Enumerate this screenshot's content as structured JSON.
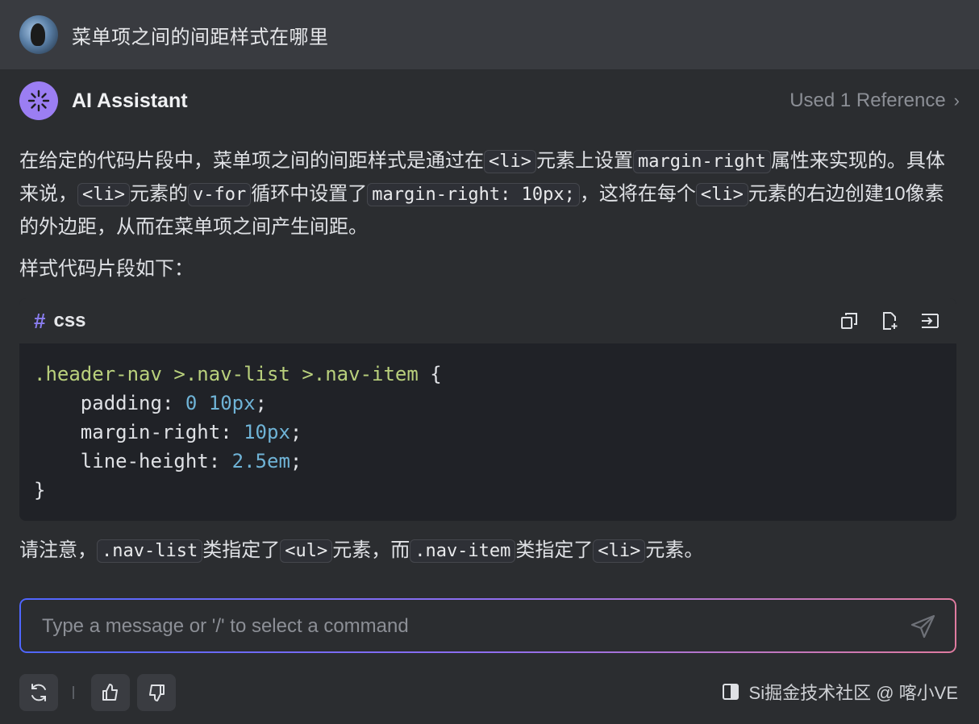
{
  "header": {
    "title": "菜单项之间的间距样式在哪里"
  },
  "assistant": {
    "name": "AI Assistant",
    "reference": "Used 1 Reference"
  },
  "answer": {
    "p1_a": "在给定的代码片段中，菜单项之间的间距样式是通过在",
    "p1_code1": "<li>",
    "p1_b": "元素上设置",
    "p1_code2": "margin-right",
    "p1_c": "属性来实现的。具体来说，",
    "p1_code3": "<li>",
    "p1_d": "元素的",
    "p1_code4": "v-for",
    "p1_e": "循环中设置了",
    "p1_code5": "margin-right: 10px;",
    "p1_f": "，这将在每个",
    "p1_code6": "<li>",
    "p1_g": "元素的右边创建10像素的外边距，从而在菜单项之间产生间距。",
    "p2": "样式代码片段如下：",
    "p3_a": "请注意，",
    "p3_code1": ".nav-list",
    "p3_b": "类指定了",
    "p3_code2": "<ul>",
    "p3_c": "元素，而",
    "p3_code3": ".nav-item",
    "p3_d": "类指定了",
    "p3_code4": "<li>",
    "p3_e": "元素。"
  },
  "code_block": {
    "hash": "#",
    "language": "css",
    "line1_selector": ".header-nav >.nav-list >.nav-item",
    "line1_brace": " {",
    "line2_prop": "    padding: ",
    "line2_val": "0 10px",
    "line3_prop": "    margin-right: ",
    "line3_val": "10px",
    "line4_prop": "    line-height: ",
    "line4_val": "2.5em",
    "semicolon": ";",
    "line5": "}"
  },
  "input": {
    "placeholder": "Type a message or '/' to select a command"
  },
  "watermark": {
    "text": "Si掘金技术社区 @ 喀小VE"
  },
  "colors": {
    "accent": "#9b7ef3",
    "background": "#2b2d30",
    "header": "#393b40",
    "code_selector": "#b9d07c",
    "code_number": "#6fb3d6"
  }
}
